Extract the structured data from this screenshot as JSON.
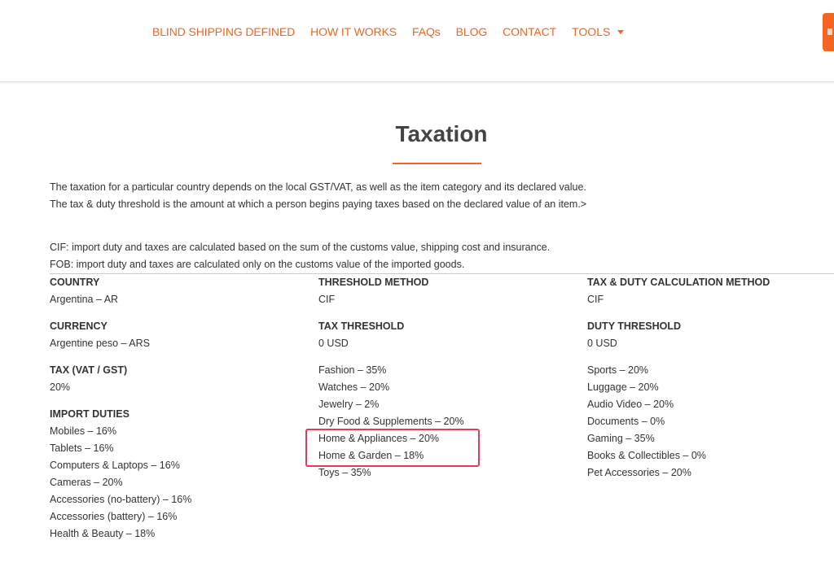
{
  "nav": {
    "items": [
      "BLIND SHIPPING DEFINED",
      "HOW IT WORKS",
      "FAQs",
      "BLOG",
      "CONTACT"
    ],
    "tools_label": "TOOLS"
  },
  "page": {
    "title": "Taxation",
    "intro": [
      "The taxation for a particular country depends on the local GST/VAT, as well as the item category and its declared value.",
      "The tax & duty threshold is the amount at which a person begins paying taxes based on the declared value of an item.>"
    ],
    "definitions": [
      "CIF: import duty and taxes are calculated based on the sum of the customs value, shipping cost and insurance.",
      "FOB: import duty and taxes are calculated only on the customs value of the imported goods."
    ]
  },
  "info": {
    "country_label": "COUNTRY",
    "country_value": "Argentina – AR",
    "threshold_method_label": "THRESHOLD METHOD",
    "threshold_method_value": "CIF",
    "calc_method_label": "TAX & DUTY CALCULATION METHOD",
    "calc_method_value": "CIF",
    "currency_label": "CURRENCY",
    "currency_value": "Argentine peso – ARS",
    "tax_threshold_label": "TAX THRESHOLD",
    "tax_threshold_value": "0 USD",
    "duty_threshold_label": "DUTY THRESHOLD",
    "duty_threshold_value": "0 USD",
    "tax_label": "TAX (VAT / GST)",
    "tax_value": "20%"
  },
  "duties": {
    "label": "IMPORT DUTIES",
    "col1": [
      "Mobiles – 16%",
      "Tablets – 16%",
      "Computers & Laptops – 16%",
      "Cameras – 20%",
      "Accessories (no-battery) – 16%",
      "Accessories (battery) – 16%",
      "Health & Beauty – 18%"
    ],
    "col2": [
      "Fashion – 35%",
      "Watches – 20%",
      "Jewelry – 2%",
      "Dry Food & Supplements – 20%",
      "Home & Appliances – 20%",
      "Home & Garden – 18%",
      "Toys – 35%"
    ],
    "col3": [
      "Sports – 20%",
      "Luggage – 20%",
      "Audio Video – 20%",
      "Documents – 0%",
      "Gaming – 35%",
      "Books & Collectibles – 0%",
      "Pet Accessories – 20%"
    ]
  },
  "colors": {
    "accent": "#f26522",
    "highlight": "#e8395a"
  }
}
